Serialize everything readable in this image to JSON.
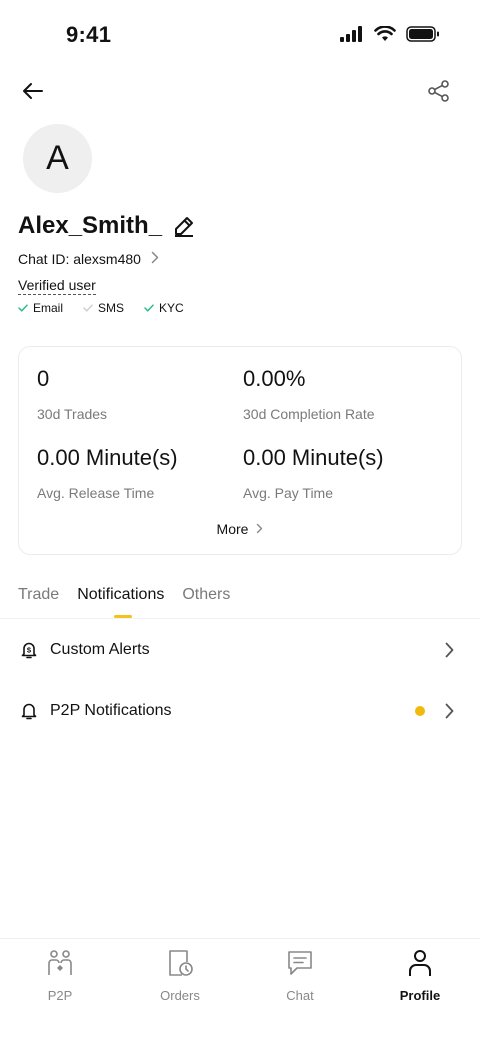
{
  "status_bar": {
    "time": "9:41",
    "icons": [
      "cellular-icon",
      "wifi-icon",
      "battery-icon"
    ]
  },
  "nav": {
    "back_icon": "arrow-left-icon",
    "share_icon": "share-icon"
  },
  "profile": {
    "avatar_letter": "A",
    "username": "Alex_Smith_",
    "chat_id": "Chat ID: alexsm480",
    "verified_label": "Verified user",
    "verifications": [
      {
        "label": "Email",
        "verified": true
      },
      {
        "label": "SMS",
        "verified": false
      },
      {
        "label": "KYC",
        "verified": true
      }
    ]
  },
  "stats": {
    "items": [
      {
        "value": "0",
        "label": "30d Trades"
      },
      {
        "value": "0.00%",
        "label": "30d Completion Rate"
      },
      {
        "value": "0.00 Minute(s)",
        "label": "Avg. Release Time"
      },
      {
        "value": "0.00 Minute(s)",
        "label": "Avg. Pay Time"
      }
    ],
    "more_label": "More"
  },
  "tabs": [
    {
      "label": "Trade",
      "active": false
    },
    {
      "label": "Notifications",
      "active": true
    },
    {
      "label": "Others",
      "active": false
    }
  ],
  "list": [
    {
      "label": "Custom Alerts",
      "icon": "alarm-bell-icon",
      "dot": false
    },
    {
      "label": "P2P Notifications",
      "icon": "bell-icon",
      "dot": true
    }
  ],
  "bottom_nav": [
    {
      "label": "P2P",
      "icon": "p2p-icon",
      "active": false
    },
    {
      "label": "Orders",
      "icon": "orders-icon",
      "active": false
    },
    {
      "label": "Chat",
      "icon": "chat-icon",
      "active": false
    },
    {
      "label": "Profile",
      "icon": "profile-icon",
      "active": true
    }
  ],
  "colors": {
    "accent": "#f0c419",
    "dot": "#f0b90b",
    "check": "#2ebd85",
    "muted": "#7a7a7a"
  }
}
